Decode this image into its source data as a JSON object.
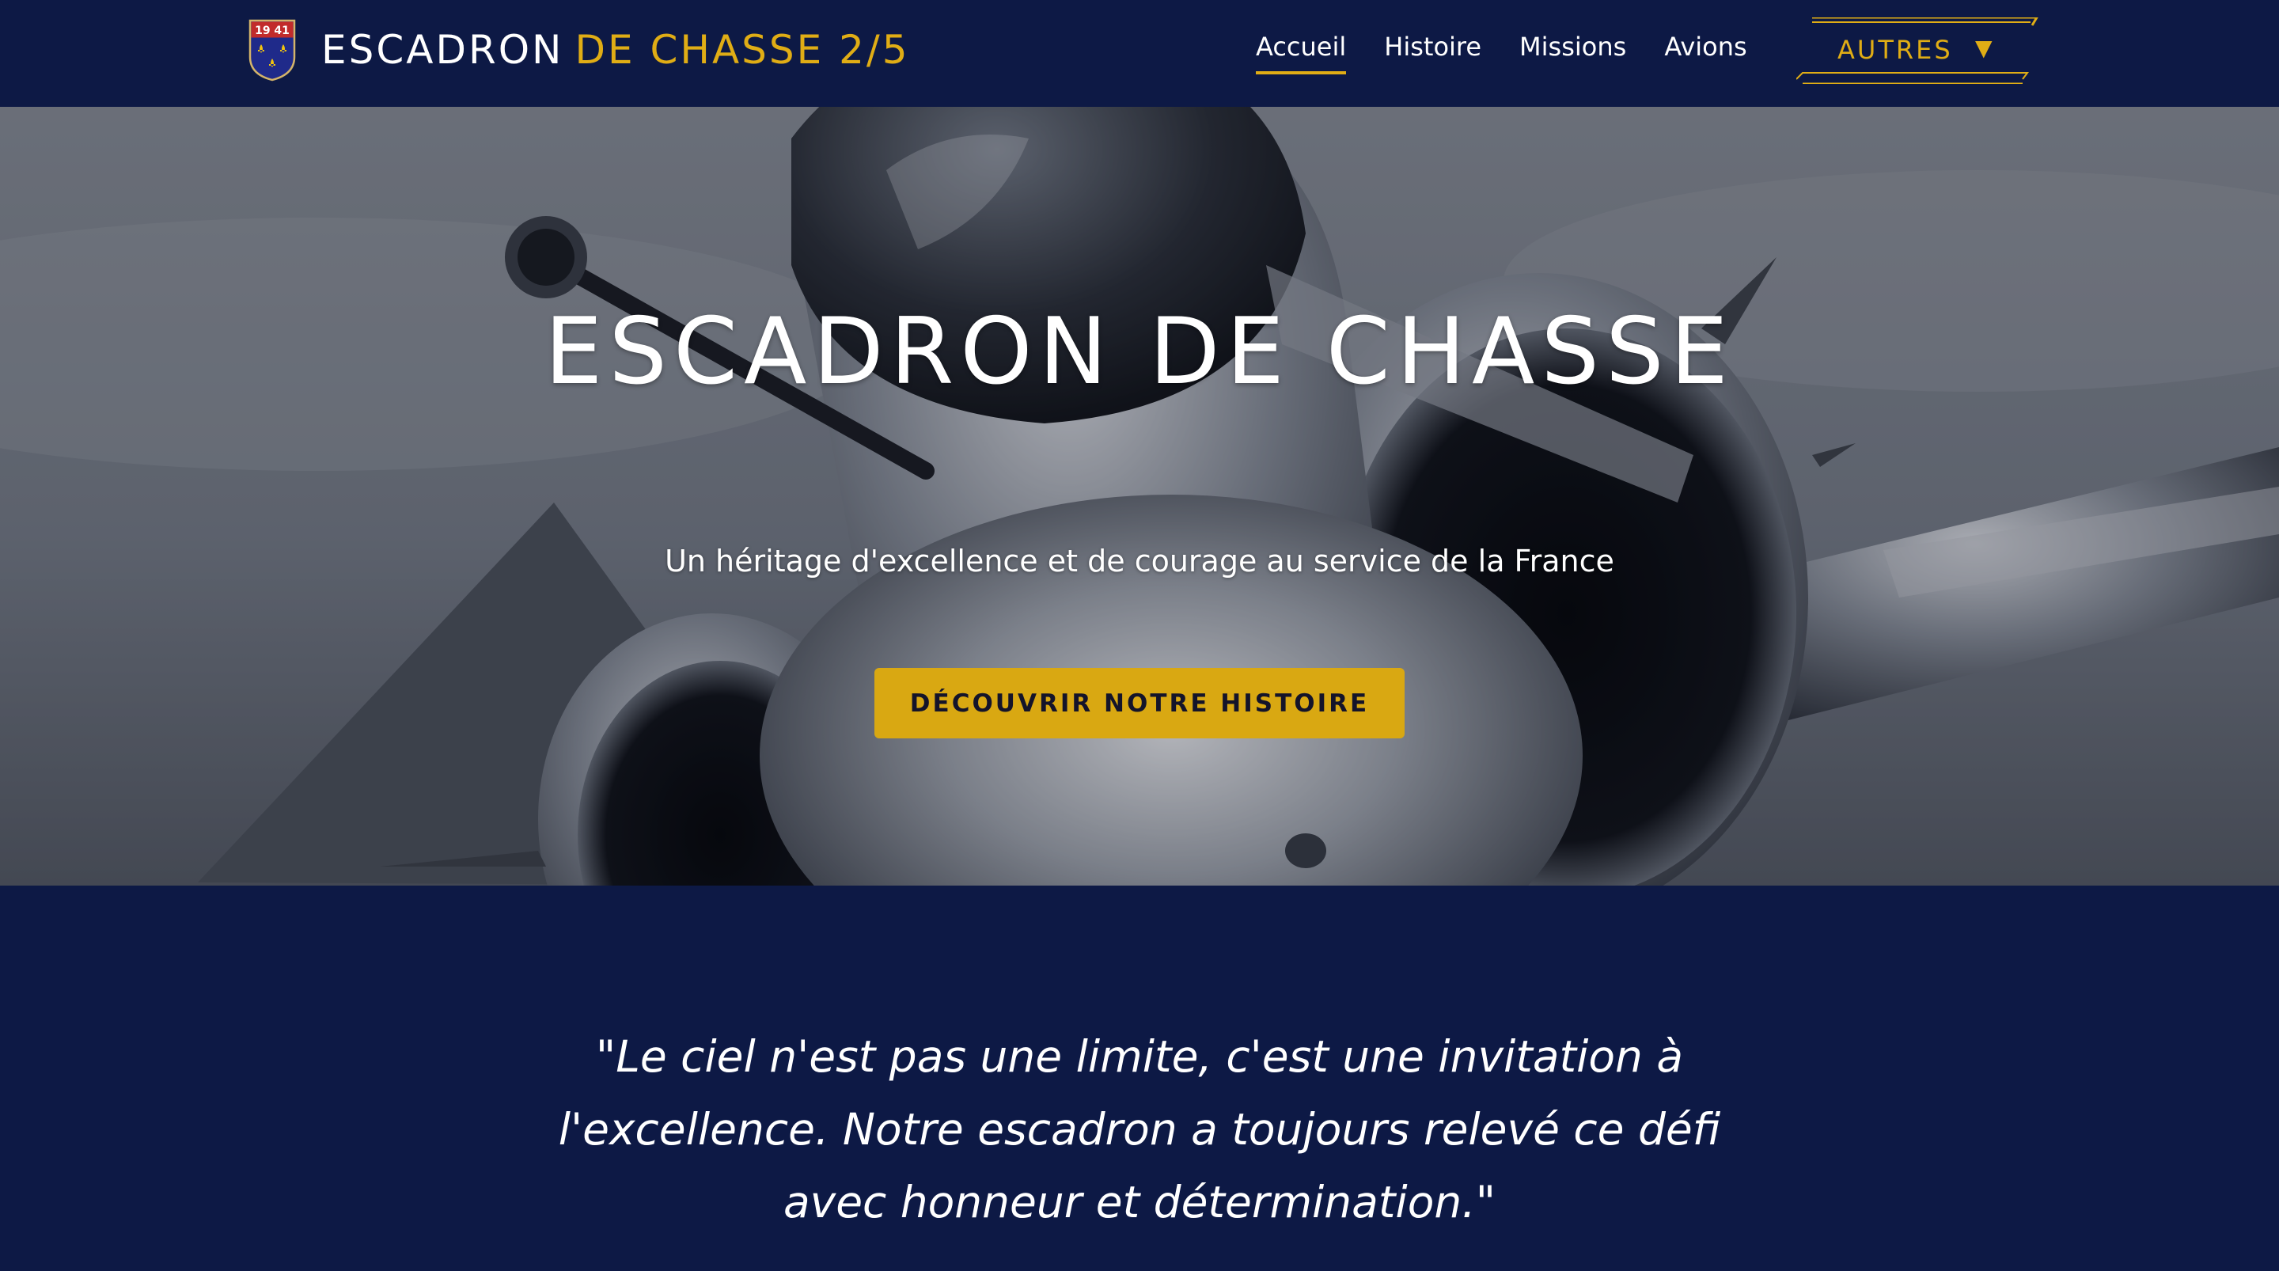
{
  "colors": {
    "navy": "#0d1945",
    "gold": "#e0ad15",
    "button_gold": "#d9a812",
    "white": "#ffffff"
  },
  "header": {
    "brand": {
      "logo_icon": "squadron-crest-icon",
      "logo_text": "19 41",
      "name_white": "ESCADRON",
      "name_gold": "DE CHASSE 2/5"
    },
    "nav": {
      "items": [
        {
          "label": "Accueil",
          "active": true
        },
        {
          "label": "Histoire",
          "active": false
        },
        {
          "label": "Missions",
          "active": false
        },
        {
          "label": "Avions",
          "active": false
        }
      ],
      "dropdown": {
        "label": "AUTRES",
        "caret": "▼"
      }
    }
  },
  "hero": {
    "background_image": "fighter-jet-photo",
    "title": "ESCADRON DE CHASSE",
    "subtitle": "Un héritage d'excellence et de courage au service de la France",
    "cta_label": "DÉCOUVRIR NOTRE HISTOIRE"
  },
  "quote": {
    "lines": [
      "\"Le ciel n'est pas une limite, c'est une invitation à",
      "l'excellence. Notre escadron a toujours relevé ce défi",
      "avec honneur et détermination.\""
    ]
  }
}
